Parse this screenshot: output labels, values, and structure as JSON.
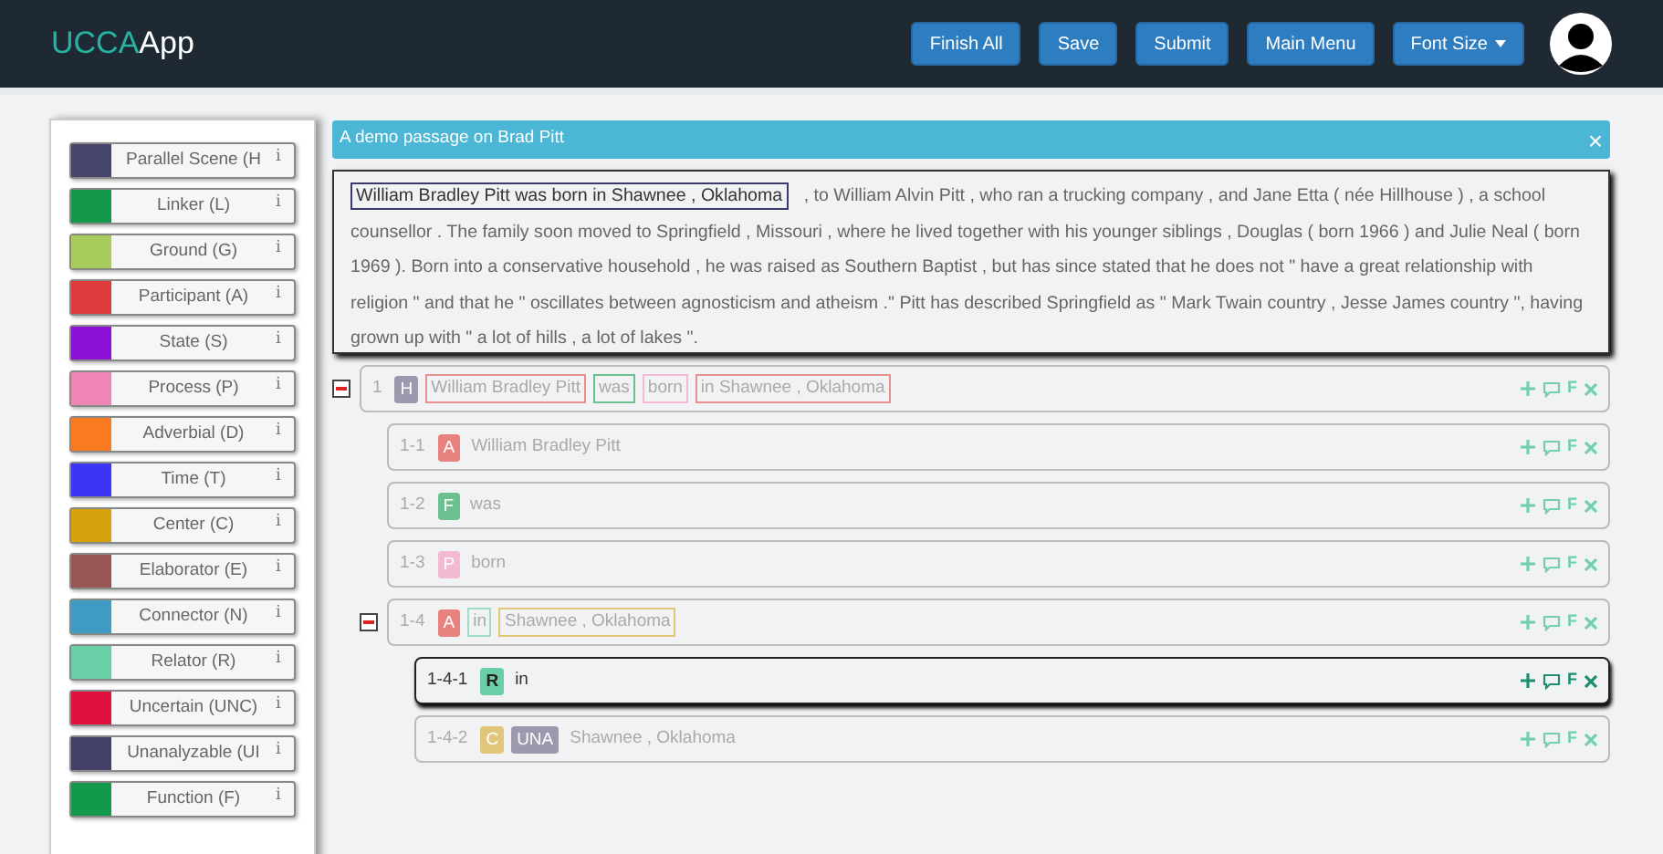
{
  "navbar": {
    "brand_part_1": "UCCA",
    "brand_part_2": "App",
    "buttons": [
      {
        "label": "Finish All",
        "dropdown": false
      },
      {
        "label": "Save",
        "dropdown": false
      },
      {
        "label": "Submit",
        "dropdown": false
      },
      {
        "label": "Main Menu",
        "dropdown": false
      },
      {
        "label": "Font Size",
        "dropdown": true
      }
    ]
  },
  "categories": [
    {
      "label": "Parallel Scene (H",
      "color": "#46456b",
      "info": "i"
    },
    {
      "label": "Linker (L)",
      "color": "#14994a",
      "info": "i"
    },
    {
      "label": "Ground (G)",
      "color": "#a8cc5c",
      "info": "i"
    },
    {
      "label": "Participant (A)",
      "color": "#dd3b3b",
      "info": "i"
    },
    {
      "label": "State (S)",
      "color": "#8d10d8",
      "info": "i"
    },
    {
      "label": "Process (P)",
      "color": "#ef85b4",
      "info": "i"
    },
    {
      "label": "Adverbial (D)",
      "color": "#f97a1f",
      "info": "i"
    },
    {
      "label": "Time (T)",
      "color": "#3b35f5",
      "info": "i"
    },
    {
      "label": "Center (C)",
      "color": "#d4a20c",
      "info": "i"
    },
    {
      "label": "Elaborator (E)",
      "color": "#9a5555",
      "info": "i"
    },
    {
      "label": "Connector (N)",
      "color": "#3f9bc4",
      "info": "i"
    },
    {
      "label": "Relator (R)",
      "color": "#68cfa7",
      "info": "i"
    },
    {
      "label": "Uncertain (UNC)",
      "color": "#e0103f",
      "info": "i"
    },
    {
      "label": "Unanalyzable (UI",
      "color": "#423f68",
      "info": "i"
    },
    {
      "label": "Function (F)",
      "color": "#13994b",
      "info": "i"
    }
  ],
  "passage": {
    "title": "A demo passage on Brad Pitt",
    "close": "×",
    "segments": [
      {
        "text": "William Bradley Pitt was born in Shawnee , Oklahoma",
        "selected": true
      },
      {
        "text": ", to William Alvin Pitt , who ran a trucking company , and Jane Etta ( née Hillhouse ) , a school counsellor . The family soon moved to Springfield , Missouri , where he lived together with his younger siblings , Douglas ( born 1966 ) and Julie Neal ( born 1969 ). Born into a conservative household , he was raised as Southern Baptist , but has since stated that he does not \" have a great relationship with religion \" and that he \" oscillates between agnosticism and atheism .\" Pitt has described Springfield as \" Mark Twain country , Jesse James country \", having grown up with \" a lot of hills , a lot of lakes \".",
        "selected": false
      }
    ]
  },
  "units": [
    {
      "index": "1",
      "expanded": true,
      "selected": false,
      "tags": [
        {
          "label": "H",
          "color": "#9a99ad"
        }
      ],
      "parts": [
        {
          "text": "William Bradley Pitt",
          "color": "#e58f8f"
        },
        {
          "text": "was",
          "color": "#6cc08f"
        },
        {
          "text": "born",
          "color": "#f3b9d1"
        },
        {
          "text": "in Shawnee , Oklahoma",
          "color": "#e58f8f"
        }
      ],
      "action": "F",
      "children": [
        {
          "index": "1-1",
          "expanded": false,
          "selected": false,
          "tags": [
            {
              "label": "A",
              "color": "#e8827f"
            }
          ],
          "parts": [
            {
              "text": "William Bradley Pitt"
            }
          ],
          "action": "F"
        },
        {
          "index": "1-2",
          "expanded": false,
          "selected": false,
          "tags": [
            {
              "label": "F",
              "color": "#6cc08f"
            }
          ],
          "parts": [
            {
              "text": "was"
            }
          ],
          "action": "F"
        },
        {
          "index": "1-3",
          "expanded": false,
          "selected": false,
          "tags": [
            {
              "label": "P",
              "color": "#f3b9d1"
            }
          ],
          "parts": [
            {
              "text": "born"
            }
          ],
          "action": "F"
        },
        {
          "index": "1-4",
          "expanded": true,
          "selected": false,
          "tags": [
            {
              "label": "A",
              "color": "#e8827f"
            }
          ],
          "parts": [
            {
              "text": "in",
              "color": "#9fdcc6"
            },
            {
              "text": "Shawnee , Oklahoma",
              "color": "#e1c67a"
            }
          ],
          "action": "F",
          "children": [
            {
              "index": "1-4-1",
              "expanded": false,
              "selected": true,
              "tags": [
                {
                  "label": "R",
                  "color": "#68cfa7"
                }
              ],
              "parts": [
                {
                  "text": "in"
                }
              ],
              "action": "F"
            },
            {
              "index": "1-4-2",
              "expanded": false,
              "selected": false,
              "tags": [
                {
                  "label": "C",
                  "color": "#e1c67a"
                },
                {
                  "label": "UNA",
                  "color": "#9a99ad"
                }
              ],
              "parts": [
                {
                  "text": "Shawnee , Oklahoma"
                }
              ],
              "action": "F"
            }
          ]
        }
      ]
    }
  ]
}
